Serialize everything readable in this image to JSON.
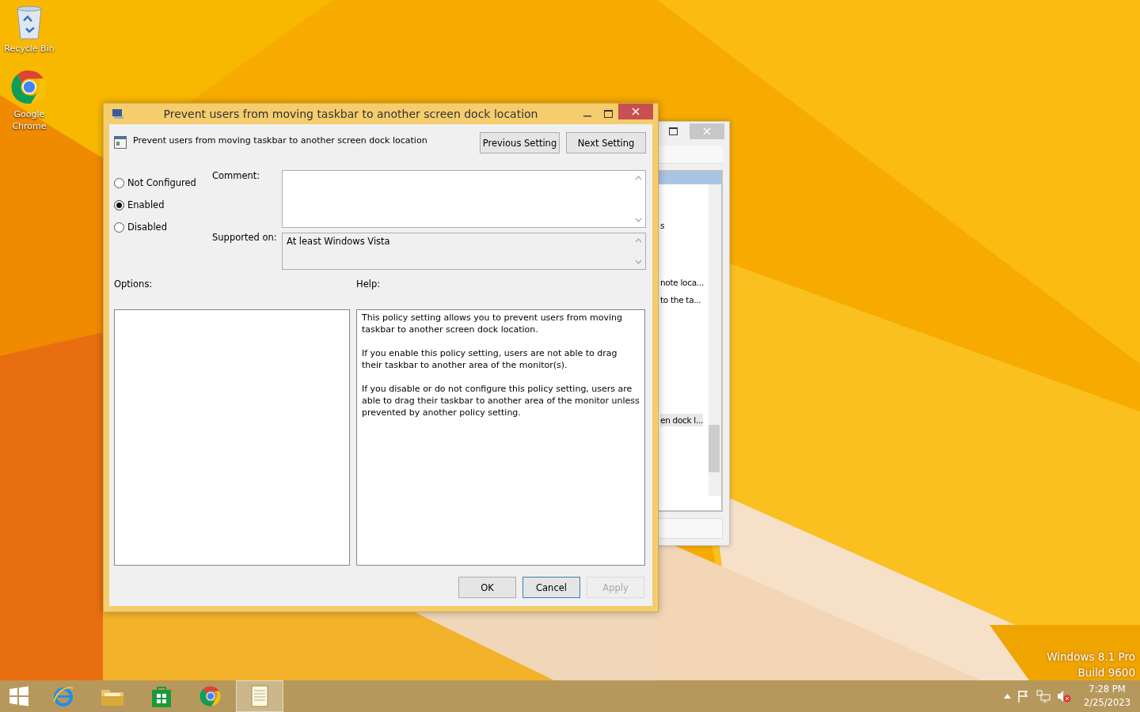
{
  "desktop_icons": [
    {
      "kind": "recycle-bin",
      "label": "Recycle Bin"
    },
    {
      "kind": "chrome",
      "label": "Google Chrome"
    }
  ],
  "back_window": {
    "rows": [
      {
        "text": "s",
        "selected": false
      },
      {
        "text": "note loca...",
        "selected": false
      },
      {
        "text": "to the ta...",
        "selected": false
      },
      {
        "text": "en dock l...",
        "selected": true
      }
    ]
  },
  "dialog": {
    "title": "Prevent users from moving taskbar to another screen dock location",
    "setting_name": "Prevent users from moving taskbar to another screen dock location",
    "nav_buttons": [
      "Previous Setting",
      "Next Setting"
    ],
    "states": [
      {
        "label": "Not Configured",
        "selected": false
      },
      {
        "label": "Enabled",
        "selected": true
      },
      {
        "label": "Disabled",
        "selected": false
      }
    ],
    "comment_label": "Comment:",
    "supported_label": "Supported on:",
    "supported_value": "At least Windows Vista",
    "options_label": "Options:",
    "help_label": "Help:",
    "help_paragraphs": [
      "This policy setting allows you to prevent users from moving taskbar to another screen dock location.",
      "If you enable this policy setting, users are not able to drag their taskbar to another area of the monitor(s).",
      "If you disable or do not configure this policy setting, users are able to drag their taskbar to another area of the monitor unless prevented by another policy setting."
    ],
    "buttons": [
      {
        "label": "OK",
        "disabled": false,
        "focused": false
      },
      {
        "label": "Cancel",
        "disabled": false,
        "focused": true
      },
      {
        "label": "Apply",
        "disabled": true,
        "focused": false
      }
    ]
  },
  "os_edition": [
    "Windows 8.1 Pro",
    "Build 9600"
  ],
  "taskbar": {
    "apps": [
      {
        "kind": "ie",
        "active": false
      },
      {
        "kind": "explorer",
        "active": false
      },
      {
        "kind": "store",
        "active": false
      },
      {
        "kind": "chrome",
        "active": false
      },
      {
        "kind": "notepad",
        "active": true
      }
    ],
    "clock": {
      "time": "7:28 PM",
      "date": "2/25/2023"
    }
  }
}
